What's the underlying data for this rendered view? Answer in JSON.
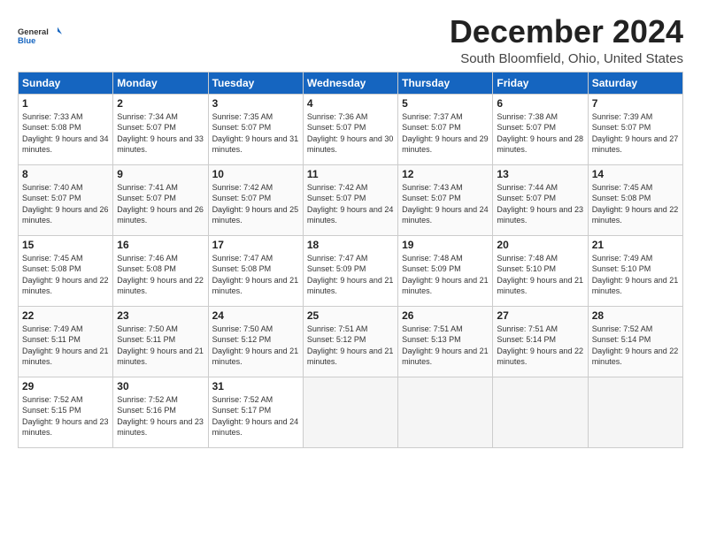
{
  "header": {
    "logo_line1": "General",
    "logo_line2": "Blue",
    "month": "December 2024",
    "location": "South Bloomfield, Ohio, United States"
  },
  "days_of_week": [
    "Sunday",
    "Monday",
    "Tuesday",
    "Wednesday",
    "Thursday",
    "Friday",
    "Saturday"
  ],
  "weeks": [
    [
      {
        "day": "1",
        "sunrise": "Sunrise: 7:33 AM",
        "sunset": "Sunset: 5:08 PM",
        "daylight": "Daylight: 9 hours and 34 minutes."
      },
      {
        "day": "2",
        "sunrise": "Sunrise: 7:34 AM",
        "sunset": "Sunset: 5:07 PM",
        "daylight": "Daylight: 9 hours and 33 minutes."
      },
      {
        "day": "3",
        "sunrise": "Sunrise: 7:35 AM",
        "sunset": "Sunset: 5:07 PM",
        "daylight": "Daylight: 9 hours and 31 minutes."
      },
      {
        "day": "4",
        "sunrise": "Sunrise: 7:36 AM",
        "sunset": "Sunset: 5:07 PM",
        "daylight": "Daylight: 9 hours and 30 minutes."
      },
      {
        "day": "5",
        "sunrise": "Sunrise: 7:37 AM",
        "sunset": "Sunset: 5:07 PM",
        "daylight": "Daylight: 9 hours and 29 minutes."
      },
      {
        "day": "6",
        "sunrise": "Sunrise: 7:38 AM",
        "sunset": "Sunset: 5:07 PM",
        "daylight": "Daylight: 9 hours and 28 minutes."
      },
      {
        "day": "7",
        "sunrise": "Sunrise: 7:39 AM",
        "sunset": "Sunset: 5:07 PM",
        "daylight": "Daylight: 9 hours and 27 minutes."
      }
    ],
    [
      {
        "day": "8",
        "sunrise": "Sunrise: 7:40 AM",
        "sunset": "Sunset: 5:07 PM",
        "daylight": "Daylight: 9 hours and 26 minutes."
      },
      {
        "day": "9",
        "sunrise": "Sunrise: 7:41 AM",
        "sunset": "Sunset: 5:07 PM",
        "daylight": "Daylight: 9 hours and 26 minutes."
      },
      {
        "day": "10",
        "sunrise": "Sunrise: 7:42 AM",
        "sunset": "Sunset: 5:07 PM",
        "daylight": "Daylight: 9 hours and 25 minutes."
      },
      {
        "day": "11",
        "sunrise": "Sunrise: 7:42 AM",
        "sunset": "Sunset: 5:07 PM",
        "daylight": "Daylight: 9 hours and 24 minutes."
      },
      {
        "day": "12",
        "sunrise": "Sunrise: 7:43 AM",
        "sunset": "Sunset: 5:07 PM",
        "daylight": "Daylight: 9 hours and 24 minutes."
      },
      {
        "day": "13",
        "sunrise": "Sunrise: 7:44 AM",
        "sunset": "Sunset: 5:07 PM",
        "daylight": "Daylight: 9 hours and 23 minutes."
      },
      {
        "day": "14",
        "sunrise": "Sunrise: 7:45 AM",
        "sunset": "Sunset: 5:08 PM",
        "daylight": "Daylight: 9 hours and 22 minutes."
      }
    ],
    [
      {
        "day": "15",
        "sunrise": "Sunrise: 7:45 AM",
        "sunset": "Sunset: 5:08 PM",
        "daylight": "Daylight: 9 hours and 22 minutes."
      },
      {
        "day": "16",
        "sunrise": "Sunrise: 7:46 AM",
        "sunset": "Sunset: 5:08 PM",
        "daylight": "Daylight: 9 hours and 22 minutes."
      },
      {
        "day": "17",
        "sunrise": "Sunrise: 7:47 AM",
        "sunset": "Sunset: 5:08 PM",
        "daylight": "Daylight: 9 hours and 21 minutes."
      },
      {
        "day": "18",
        "sunrise": "Sunrise: 7:47 AM",
        "sunset": "Sunset: 5:09 PM",
        "daylight": "Daylight: 9 hours and 21 minutes."
      },
      {
        "day": "19",
        "sunrise": "Sunrise: 7:48 AM",
        "sunset": "Sunset: 5:09 PM",
        "daylight": "Daylight: 9 hours and 21 minutes."
      },
      {
        "day": "20",
        "sunrise": "Sunrise: 7:48 AM",
        "sunset": "Sunset: 5:10 PM",
        "daylight": "Daylight: 9 hours and 21 minutes."
      },
      {
        "day": "21",
        "sunrise": "Sunrise: 7:49 AM",
        "sunset": "Sunset: 5:10 PM",
        "daylight": "Daylight: 9 hours and 21 minutes."
      }
    ],
    [
      {
        "day": "22",
        "sunrise": "Sunrise: 7:49 AM",
        "sunset": "Sunset: 5:11 PM",
        "daylight": "Daylight: 9 hours and 21 minutes."
      },
      {
        "day": "23",
        "sunrise": "Sunrise: 7:50 AM",
        "sunset": "Sunset: 5:11 PM",
        "daylight": "Daylight: 9 hours and 21 minutes."
      },
      {
        "day": "24",
        "sunrise": "Sunrise: 7:50 AM",
        "sunset": "Sunset: 5:12 PM",
        "daylight": "Daylight: 9 hours and 21 minutes."
      },
      {
        "day": "25",
        "sunrise": "Sunrise: 7:51 AM",
        "sunset": "Sunset: 5:12 PM",
        "daylight": "Daylight: 9 hours and 21 minutes."
      },
      {
        "day": "26",
        "sunrise": "Sunrise: 7:51 AM",
        "sunset": "Sunset: 5:13 PM",
        "daylight": "Daylight: 9 hours and 21 minutes."
      },
      {
        "day": "27",
        "sunrise": "Sunrise: 7:51 AM",
        "sunset": "Sunset: 5:14 PM",
        "daylight": "Daylight: 9 hours and 22 minutes."
      },
      {
        "day": "28",
        "sunrise": "Sunrise: 7:52 AM",
        "sunset": "Sunset: 5:14 PM",
        "daylight": "Daylight: 9 hours and 22 minutes."
      }
    ],
    [
      {
        "day": "29",
        "sunrise": "Sunrise: 7:52 AM",
        "sunset": "Sunset: 5:15 PM",
        "daylight": "Daylight: 9 hours and 23 minutes."
      },
      {
        "day": "30",
        "sunrise": "Sunrise: 7:52 AM",
        "sunset": "Sunset: 5:16 PM",
        "daylight": "Daylight: 9 hours and 23 minutes."
      },
      {
        "day": "31",
        "sunrise": "Sunrise: 7:52 AM",
        "sunset": "Sunset: 5:17 PM",
        "daylight": "Daylight: 9 hours and 24 minutes."
      },
      null,
      null,
      null,
      null
    ]
  ]
}
